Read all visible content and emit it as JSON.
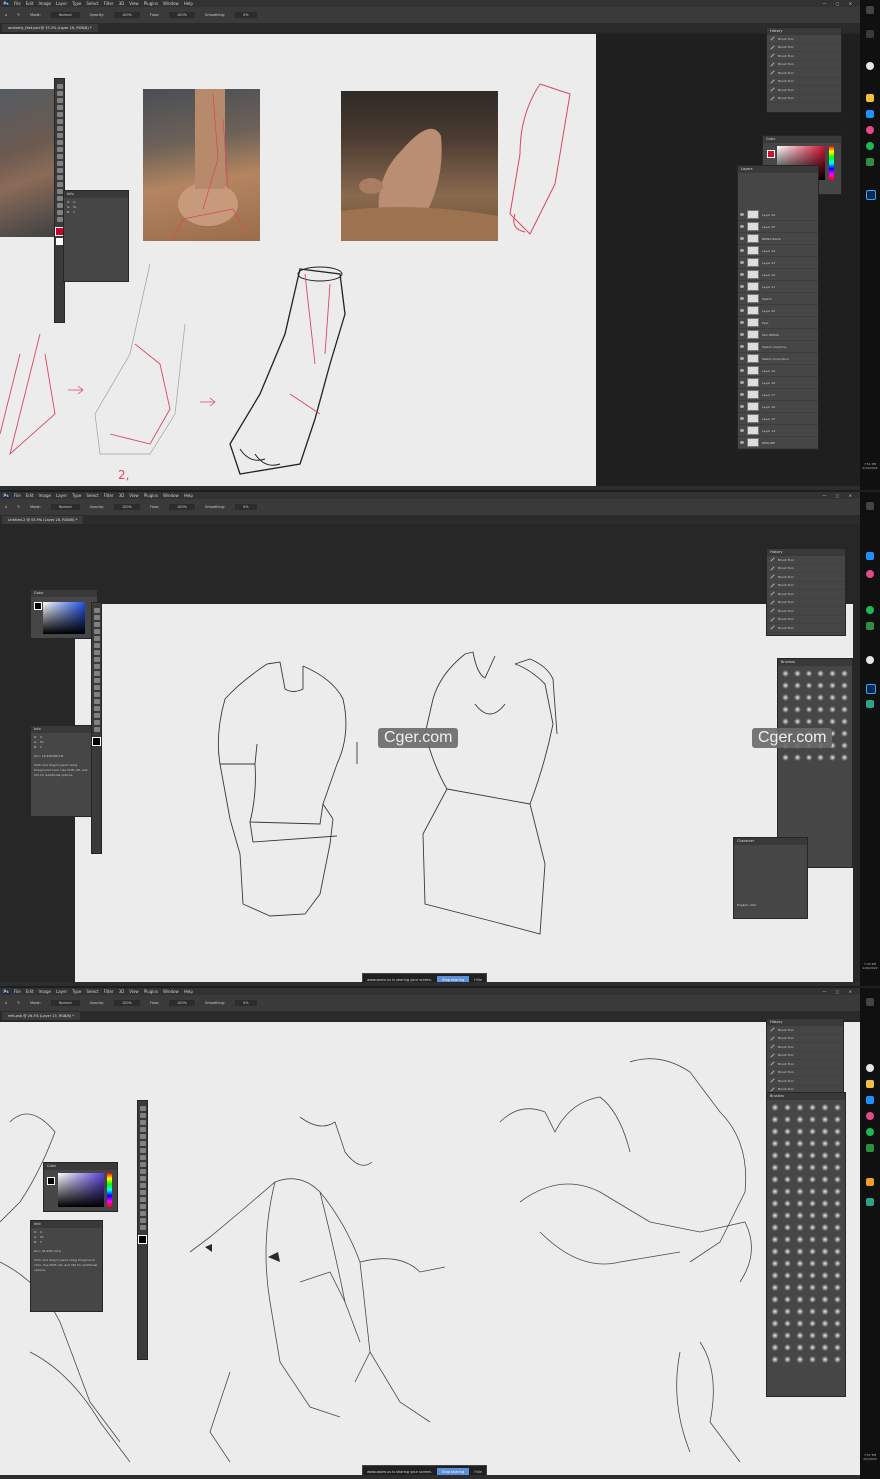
{
  "menus": [
    "File",
    "Edit",
    "Image",
    "Layer",
    "Type",
    "Select",
    "Filter",
    "3D",
    "View",
    "Plugins",
    "Window",
    "Help"
  ],
  "options": {
    "mode_label": "Mode:",
    "mode_value": "Normal",
    "opacity_label": "Opacity:",
    "opacity_value": "100%",
    "flow_label": "Flow:",
    "flow_value": "100%",
    "smoothing_label": "Smoothing:",
    "smoothing_value": "0%"
  },
  "shot1": {
    "tab": "anatomy_feet.psd @ 33.3% (Layer 16, RGB/8) *",
    "panels": {
      "history": "History",
      "color": "Color",
      "layers": "Layers"
    },
    "history_items": [
      "Brush Tool",
      "Brush Tool",
      "Brush Tool",
      "Brush Tool",
      "Brush Tool",
      "Brush Tool",
      "Brush Tool",
      "Brush Tool",
      "Brush Tool",
      "Brush Tool"
    ],
    "layers": [
      "Layer 26",
      "Layer 25",
      "BRING BACK",
      "Layer 24",
      "Layer 23",
      "Layer 22",
      "Layer 21",
      "Sketch",
      "Layer 20",
      "Feet",
      "Skin BRING",
      "Sketch anatomy",
      "Sketch proportion",
      "Layer 19",
      "Layer 18",
      "Layer 17",
      "Layer 16",
      "Layer 15",
      "Layer 14",
      "REDLINE"
    ],
    "time": "7:51 PM",
    "date": "2/19/2022"
  },
  "shot2": {
    "tab": "Untitled-2 @ 53.9% (Layer 28, RGB/8) *",
    "panels": {
      "color": "Color",
      "info": "Info",
      "history": "History",
      "brushes": "Brushes",
      "character": "Character"
    },
    "info_hint": "Click and drag to paint using foreground color. Use Shift, Alt, and Ctrl for additional options.",
    "doc_size": "Doc: 19.4M/288.1M",
    "history_items": [
      "Brush Tool",
      "Brush Tool",
      "Brush Tool",
      "Brush Tool",
      "Brush Tool",
      "Brush Tool",
      "Brush Tool",
      "Brush Tool",
      "Brush Tool",
      "Brush Tool"
    ],
    "share_text": "www.zoom.us is sharing your screen.",
    "share_stop": "Stop sharing",
    "share_hide": "Hide",
    "time": "7:43 PM",
    "date": "1/29/2022",
    "character_lang": "English: USA"
  },
  "shot3": {
    "tab": "refs.psb @ 26.3% (Layer 13, RGB/8) *",
    "panels": {
      "color": "Color",
      "info": "Info",
      "history": "History",
      "brushes": "Brushes"
    },
    "info_hint": "Click and drag to paint using foreground color. Use Shift, Alt, and Ctrl for additional options.",
    "doc_size": "Doc: 44.4M/1.01G",
    "history_items": [
      "Brush Tool",
      "Brush Tool",
      "Brush Tool",
      "Brush Tool",
      "Brush Tool",
      "Brush Tool",
      "Brush Tool",
      "Brush Tool"
    ],
    "share_text": "www.zoom.us is sharing your screen.",
    "share_stop": "Stop sharing",
    "share_hide": "Hide",
    "time": "7:57 PM",
    "date": "2/5/2022"
  },
  "watermark": "Cger.com",
  "colors": {
    "ui_bg": "#272727",
    "panel": "#464646",
    "canvas": "#ececec",
    "redline": "#d94860",
    "accent": "#5b8fd8"
  }
}
